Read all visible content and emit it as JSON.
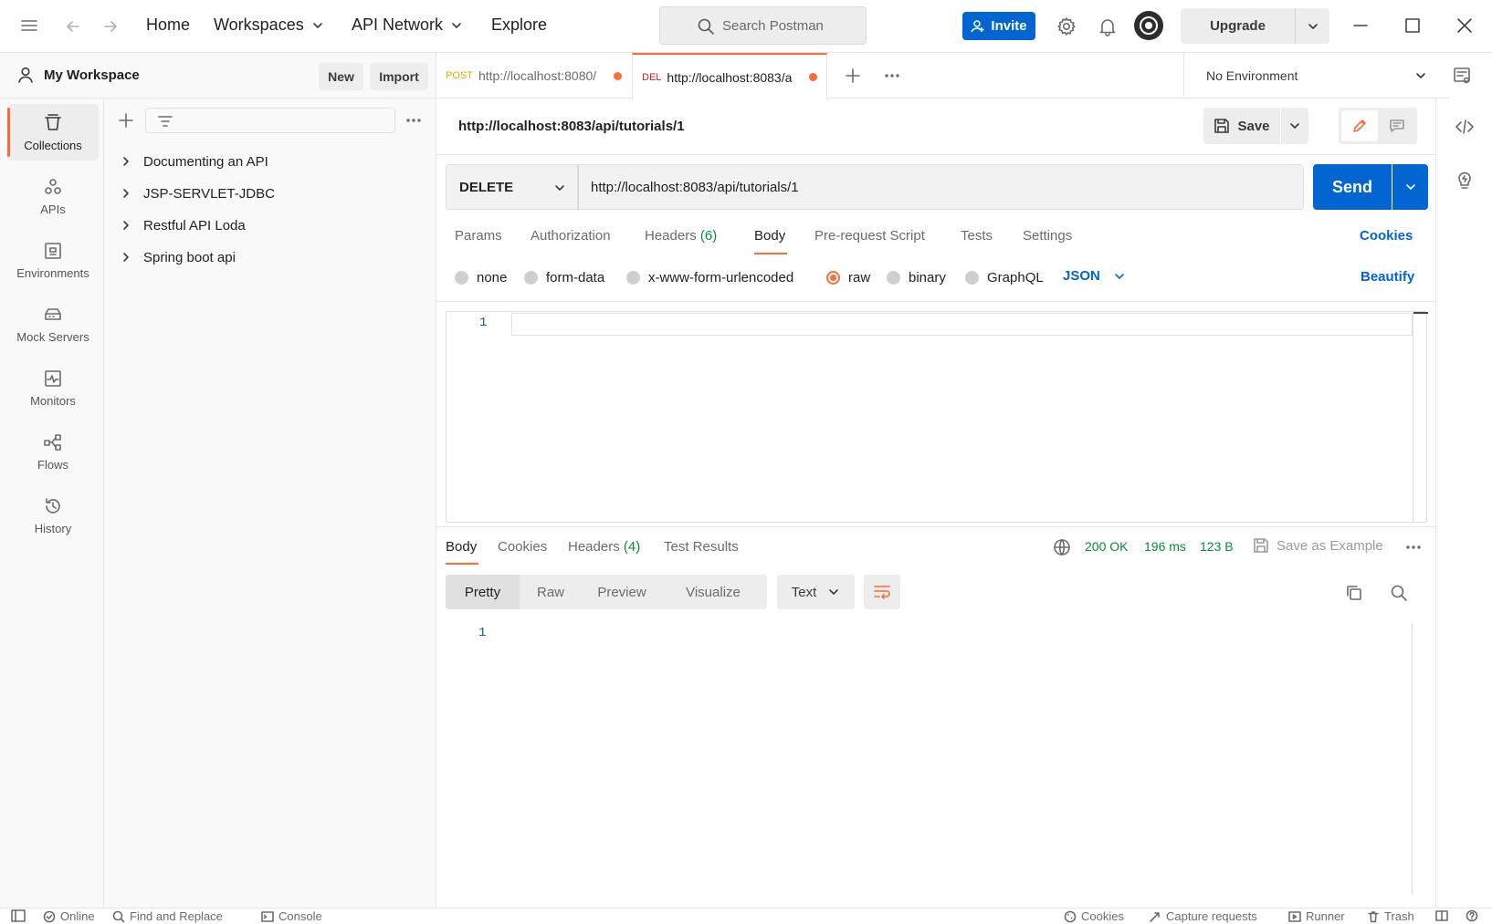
{
  "header": {
    "nav": [
      "Home",
      "Workspaces",
      "API Network",
      "Explore"
    ],
    "search_placeholder": "Search Postman",
    "invite_label": "Invite",
    "upgrade_label": "Upgrade"
  },
  "workspace": {
    "title": "My Workspace",
    "new_label": "New",
    "import_label": "Import"
  },
  "leftnav": [
    {
      "label": "Collections",
      "icon": "collections-icon"
    },
    {
      "label": "APIs",
      "icon": "apis-icon"
    },
    {
      "label": "Environments",
      "icon": "environments-icon"
    },
    {
      "label": "Mock Servers",
      "icon": "mock-servers-icon"
    },
    {
      "label": "Monitors",
      "icon": "monitors-icon"
    },
    {
      "label": "Flows",
      "icon": "flows-icon"
    },
    {
      "label": "History",
      "icon": "history-icon"
    }
  ],
  "collections": [
    "Documenting an API",
    "JSP-SERVLET-JDBC",
    "Restful API Loda",
    "Spring boot api"
  ],
  "tabs": [
    {
      "method": "POST",
      "url": "http://localhost:8080/",
      "method_color": "#f2a200"
    },
    {
      "method": "DEL",
      "url": "http://localhost:8083/a",
      "method_color": "#d12020"
    }
  ],
  "environment": "No Environment",
  "request": {
    "title": "http://localhost:8083/api/tutorials/1",
    "save_label": "Save",
    "method": "DELETE",
    "url": "http://localhost:8083/api/tutorials/1",
    "send_label": "Send",
    "tabs": [
      "Params",
      "Authorization",
      "Headers",
      "Body",
      "Pre-request Script",
      "Tests",
      "Settings"
    ],
    "headers_count": "(6)",
    "cookies_label": "Cookies",
    "body_types": [
      "none",
      "form-data",
      "x-www-form-urlencoded",
      "raw",
      "binary",
      "GraphQL"
    ],
    "body_format": "JSON",
    "beautify_label": "Beautify",
    "line_number": "1"
  },
  "response": {
    "tabs": [
      "Body",
      "Cookies",
      "Headers",
      "Test Results"
    ],
    "headers_count": "(4)",
    "status": "200 OK",
    "time": "196 ms",
    "size": "123 B",
    "save_example_label": "Save as Example",
    "views": [
      "Pretty",
      "Raw",
      "Preview",
      "Visualize"
    ],
    "format": "Text",
    "line_number": "1"
  },
  "footer": {
    "online": "Online",
    "find_replace": "Find and Replace",
    "console": "Console",
    "cookies": "Cookies",
    "capture": "Capture requests",
    "runner": "Runner",
    "trash": "Trash"
  },
  "colors": {
    "accent": "#ff6c37",
    "primary": "#0265d2",
    "success": "#0b8a3e"
  }
}
